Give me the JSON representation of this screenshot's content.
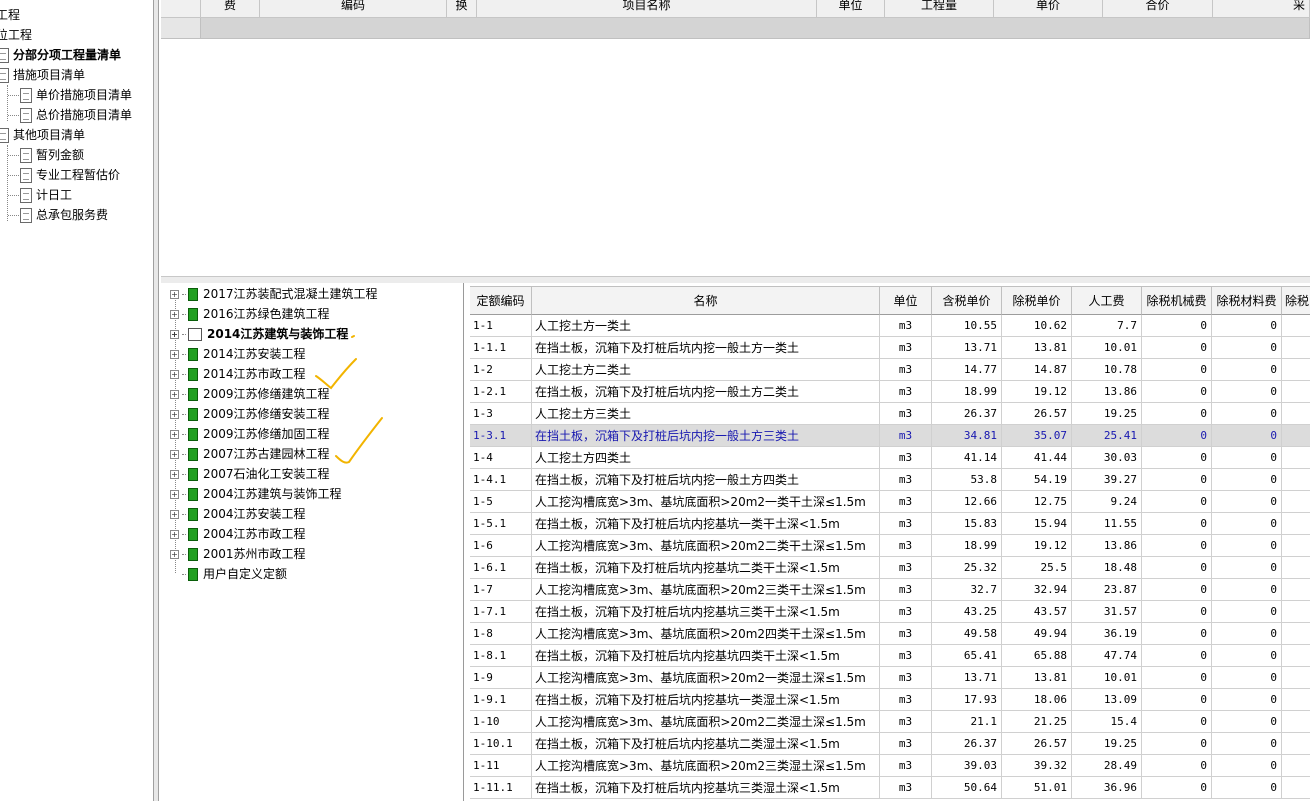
{
  "left_tree": {
    "items": [
      {
        "label": "工程",
        "level": 0,
        "bold": false
      },
      {
        "label": "位工程",
        "level": 0,
        "bold": false
      },
      {
        "label": "分部分项工程量清单",
        "level": 1,
        "bold": true,
        "icon": "edit-doc-icon"
      },
      {
        "label": "措施项目清单",
        "level": 1,
        "bold": false,
        "icon": "folder-doc-icon"
      },
      {
        "label": "单价措施项目清单",
        "level": 2,
        "bold": false,
        "icon": "doc-icon"
      },
      {
        "label": "总价措施项目清单",
        "level": 2,
        "bold": false,
        "icon": "doc-icon"
      },
      {
        "label": "其他项目清单",
        "level": 1,
        "bold": false,
        "icon": "folder-doc-icon"
      },
      {
        "label": "暂列金额",
        "level": 2,
        "bold": false,
        "icon": "doc-icon"
      },
      {
        "label": "专业工程暂估价",
        "level": 2,
        "bold": false,
        "icon": "doc-icon"
      },
      {
        "label": "计日工",
        "level": 2,
        "bold": false,
        "icon": "doc-icon"
      },
      {
        "label": "总承包服务费",
        "level": 2,
        "bold": false,
        "icon": "doc-icon"
      }
    ]
  },
  "top_grid": {
    "headers": [
      "费",
      "编码",
      "换",
      "项目名称",
      "单位",
      "工程量",
      "单价",
      "合价",
      "采"
    ]
  },
  "library_tree": {
    "items": [
      {
        "label": "2017江苏装配式混凝土建筑工程",
        "bold": false,
        "open": false
      },
      {
        "label": "2016江苏绿色建筑工程",
        "bold": false,
        "open": false
      },
      {
        "label": "2014江苏建筑与装饰工程",
        "bold": true,
        "open": true
      },
      {
        "label": "2014江苏安装工程",
        "bold": false,
        "open": false
      },
      {
        "label": "2014江苏市政工程",
        "bold": false,
        "open": false
      },
      {
        "label": "2009江苏修缮建筑工程",
        "bold": false,
        "open": false
      },
      {
        "label": "2009江苏修缮安装工程",
        "bold": false,
        "open": false
      },
      {
        "label": "2009江苏修缮加固工程",
        "bold": false,
        "open": false
      },
      {
        "label": "2007江苏古建园林工程",
        "bold": false,
        "open": false
      },
      {
        "label": "2007石油化工安装工程",
        "bold": false,
        "open": false
      },
      {
        "label": "2004江苏建筑与装饰工程",
        "bold": false,
        "open": false
      },
      {
        "label": "2004江苏安装工程",
        "bold": false,
        "open": false
      },
      {
        "label": "2004江苏市政工程",
        "bold": false,
        "open": false
      },
      {
        "label": "2001苏州市政工程",
        "bold": false,
        "open": false
      },
      {
        "label": "用户自定义定额",
        "bold": false,
        "open": false,
        "leaf": true
      }
    ]
  },
  "quota_grid": {
    "headers": [
      "定额编码",
      "名称",
      "单位",
      "含税单价",
      "除税单价",
      "人工费",
      "除税机械费",
      "除税材料费",
      "除税"
    ],
    "selected_row": 5,
    "rows": [
      [
        "1-1",
        "人工挖土方一类土",
        "m3",
        "10.55",
        "10.62",
        "7.7",
        "0",
        "0"
      ],
      [
        "1-1.1",
        "在挡土板，沉箱下及打桩后坑内挖一般土方一类土",
        "m3",
        "13.71",
        "13.81",
        "10.01",
        "0",
        "0"
      ],
      [
        "1-2",
        "人工挖土方二类土",
        "m3",
        "14.77",
        "14.87",
        "10.78",
        "0",
        "0"
      ],
      [
        "1-2.1",
        "在挡土板，沉箱下及打桩后坑内挖一般土方二类土",
        "m3",
        "18.99",
        "19.12",
        "13.86",
        "0",
        "0"
      ],
      [
        "1-3",
        "人工挖土方三类土",
        "m3",
        "26.37",
        "26.57",
        "19.25",
        "0",
        "0"
      ],
      [
        "1-3.1",
        "在挡土板，沉箱下及打桩后坑内挖一般土方三类土",
        "m3",
        "34.81",
        "35.07",
        "25.41",
        "0",
        "0"
      ],
      [
        "1-4",
        "人工挖土方四类土",
        "m3",
        "41.14",
        "41.44",
        "30.03",
        "0",
        "0"
      ],
      [
        "1-4.1",
        "在挡土板，沉箱下及打桩后坑内挖一般土方四类土",
        "m3",
        "53.8",
        "54.19",
        "39.27",
        "0",
        "0"
      ],
      [
        "1-5",
        "人工挖沟槽底宽>3m、基坑底面积>20m2一类干土深≤1.5m",
        "m3",
        "12.66",
        "12.75",
        "9.24",
        "0",
        "0"
      ],
      [
        "1-5.1",
        "在挡土板，沉箱下及打桩后坑内挖基坑一类干土深<1.5m",
        "m3",
        "15.83",
        "15.94",
        "11.55",
        "0",
        "0"
      ],
      [
        "1-6",
        "人工挖沟槽底宽>3m、基坑底面积>20m2二类干土深≤1.5m",
        "m3",
        "18.99",
        "19.12",
        "13.86",
        "0",
        "0"
      ],
      [
        "1-6.1",
        "在挡土板，沉箱下及打桩后坑内挖基坑二类干土深<1.5m",
        "m3",
        "25.32",
        "25.5",
        "18.48",
        "0",
        "0"
      ],
      [
        "1-7",
        "人工挖沟槽底宽>3m、基坑底面积>20m2三类干土深≤1.5m",
        "m3",
        "32.7",
        "32.94",
        "23.87",
        "0",
        "0"
      ],
      [
        "1-7.1",
        "在挡土板，沉箱下及打桩后坑内挖基坑三类干土深<1.5m",
        "m3",
        "43.25",
        "43.57",
        "31.57",
        "0",
        "0"
      ],
      [
        "1-8",
        "人工挖沟槽底宽>3m、基坑底面积>20m2四类干土深≤1.5m",
        "m3",
        "49.58",
        "49.94",
        "36.19",
        "0",
        "0"
      ],
      [
        "1-8.1",
        "在挡土板，沉箱下及打桩后坑内挖基坑四类干土深<1.5m",
        "m3",
        "65.41",
        "65.88",
        "47.74",
        "0",
        "0"
      ],
      [
        "1-9",
        "人工挖沟槽底宽>3m、基坑底面积>20m2一类湿土深≤1.5m",
        "m3",
        "13.71",
        "13.81",
        "10.01",
        "0",
        "0"
      ],
      [
        "1-9.1",
        "在挡土板，沉箱下及打桩后坑内挖基坑一类湿土深<1.5m",
        "m3",
        "17.93",
        "18.06",
        "13.09",
        "0",
        "0"
      ],
      [
        "1-10",
        "人工挖沟槽底宽>3m、基坑底面积>20m2二类湿土深≤1.5m",
        "m3",
        "21.1",
        "21.25",
        "15.4",
        "0",
        "0"
      ],
      [
        "1-10.1",
        "在挡土板，沉箱下及打桩后坑内挖基坑二类湿土深<1.5m",
        "m3",
        "26.37",
        "26.57",
        "19.25",
        "0",
        "0"
      ],
      [
        "1-11",
        "人工挖沟槽底宽>3m、基坑底面积>20m2三类湿土深≤1.5m",
        "m3",
        "39.03",
        "39.32",
        "28.49",
        "0",
        "0"
      ],
      [
        "1-11.1",
        "在挡土板，沉箱下及打桩后坑内挖基坑三类湿土深<1.5m",
        "m3",
        "50.64",
        "51.01",
        "36.96",
        "0",
        "0"
      ]
    ]
  },
  "colors": {
    "selected_text": "#1818b0",
    "selected_bg": "#dcdcdc",
    "book_icon": "#20a020",
    "hand_mark": "#f2b400"
  }
}
